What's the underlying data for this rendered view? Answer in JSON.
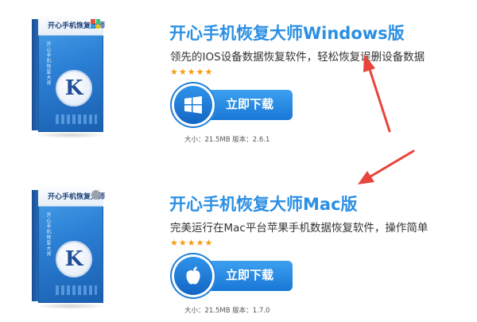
{
  "products": [
    {
      "box_title": "开心手机恢复大师",
      "box_vertical_text": "开心手机恢复大师",
      "logo_letter": "K",
      "platform_icon": "windows-icon",
      "title": "开心手机恢复大师Windows版",
      "description": "领先的IOS设备数据恢复软件，轻松恢复误删设备数据",
      "rating": "★★★★★",
      "download_label": "立即下载",
      "meta": "大小：21.5MB 版本：2.6.1"
    },
    {
      "box_title": "开心手机恢复大师",
      "box_vertical_text": "开心手机恢复大师",
      "logo_letter": "K",
      "platform_icon": "apple-icon",
      "title": "开心手机恢复大师Mac版",
      "description": "完美运行在Mac平台苹果手机数据恢复软件，操作简单",
      "rating": "★★★★★",
      "download_label": "立即下载",
      "meta": "大小：21.5MB 版本：1.7.0"
    }
  ],
  "colors": {
    "title": "#2b8fe3",
    "button": "#1f7fd8",
    "stars": "#f39c12",
    "arrow": "#e8443a"
  }
}
